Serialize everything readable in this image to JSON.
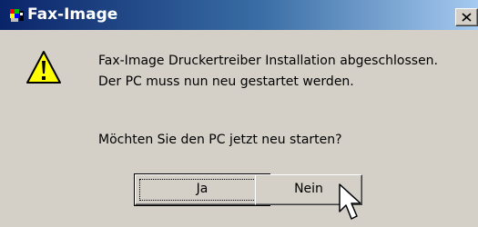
{
  "window": {
    "title": "Fax-Image",
    "close_symbol": "×"
  },
  "dialog": {
    "icon": "warning-icon",
    "message_line1": "Fax-Image Druckertreiber Installation abgeschlossen.",
    "message_line2": "Der PC muss nun neu gestartet werden.",
    "question": "Möchten Sie den PC jetzt neu starten?",
    "buttons": {
      "yes_label": "Ja",
      "no_label": "Nein"
    }
  },
  "colors": {
    "title_gradient_start": "#0a246a",
    "title_gradient_end": "#a6caf0",
    "face": "#d4d0c8",
    "warning_yellow": "#ffff00"
  }
}
